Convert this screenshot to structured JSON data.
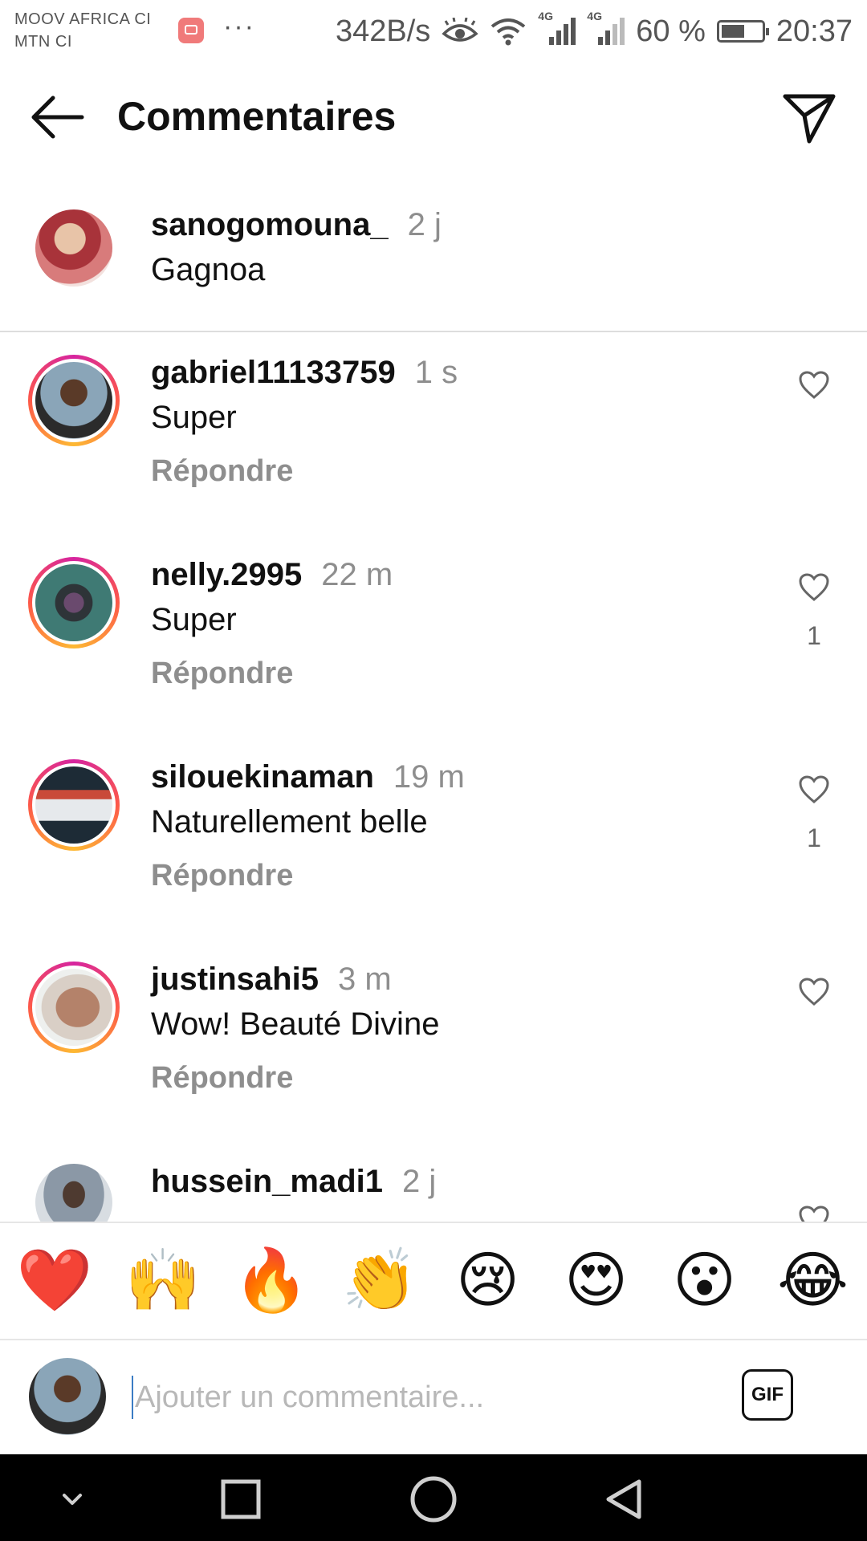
{
  "status_bar": {
    "carrier_1": "MOOV AFRICA CI",
    "carrier_2": "MTN CI",
    "more": "···",
    "speed": "342B/s",
    "net_1": "4G",
    "net_2": "4G",
    "battery": "60 %",
    "clock": "20:37"
  },
  "header": {
    "title": "Commentaires",
    "back_icon": "arrow-left-icon",
    "send_icon": "paper-plane-icon"
  },
  "caption": {
    "username": "sanogomouna_",
    "time": "2 j",
    "text": "Gagnoa"
  },
  "comments": [
    {
      "username": "gabriel11133759",
      "time": "1 s",
      "text": "Super",
      "reply": "Répondre",
      "likes": ""
    },
    {
      "username": "nelly.2995",
      "time": "22 m",
      "text": "Super",
      "reply": "Répondre",
      "likes": "1"
    },
    {
      "username": "silouekinaman",
      "time": "19 m",
      "text": "Naturellement belle",
      "reply": "Répondre",
      "likes": "1"
    },
    {
      "username": "justinsahi5",
      "time": "3 m",
      "text": "Wow! Beauté Divine",
      "reply": "Répondre",
      "likes": ""
    },
    {
      "username": "hussein_madi1",
      "time": "2 j",
      "text": "",
      "reply": "",
      "likes": ""
    }
  ],
  "emoji_bar": [
    "❤️",
    "🙌",
    "🔥",
    "👏",
    "😢",
    "😍",
    "😮",
    "😂"
  ],
  "input": {
    "placeholder": "Ajouter un commentaire...",
    "gif_label": "GIF"
  },
  "colors": {
    "story_ring_start": "#d6249f",
    "story_ring_end": "#fdb933",
    "muted_text": "#8e8e8e"
  }
}
